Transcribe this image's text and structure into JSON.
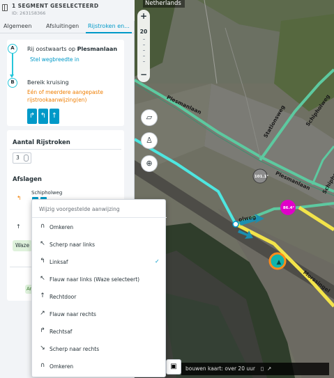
{
  "header": {
    "title": "1 SEGMENT GESELECTEERD",
    "id": "ID: 263158366"
  },
  "tabs": [
    {
      "label": "Algemeen"
    },
    {
      "label": "Afsluitingen"
    },
    {
      "label": "Rijstroken en..."
    }
  ],
  "direction": {
    "node_a": "A",
    "node_b": "B",
    "line_prefix": "Rij oostwaarts op ",
    "street": "Plesmanlaan",
    "width_link": "Stel wegbreedte in",
    "reach_junction": "Bereik kruising",
    "warning": "Eén of meerdere aangepaste rijstrookaanwijzing(en)",
    "lane_icons": [
      "↱",
      "↰",
      "↑"
    ]
  },
  "lanes": {
    "count_label": "Aantal Rijstroken",
    "count_value": "3",
    "turns_label": "Afslagen",
    "street": "Schipholweg",
    "waze_chip": "Waze",
    "bottom_chip": "An"
  },
  "map": {
    "country": "Netherlands",
    "zoom_level": "20",
    "labels": {
      "plesmanlaan_top": "Plesmanlaan",
      "plesmanlaan_mid": "Plesmanlaan",
      "stationsweg": "Stationsweg",
      "schipholweg_ne": "Schipholweg",
      "schipholweg_e": "Schipholweg",
      "schipholweg_w": "olweg",
      "morssingel": "Morssingel",
      "speed_grey": "101.1°",
      "speed_pink": "86.4°"
    },
    "footer": "bouwen kaart: over 20 uur",
    "colors": {
      "road_green": "#5dc9a0",
      "road_cyan": "#4ee6e0",
      "road_yellow": "#f2e34a",
      "accent": "#0099c8"
    }
  },
  "dropdown": {
    "heading": "Wijzig voorgestelde aanwijzing",
    "items": [
      {
        "label": "Omkeren",
        "icon": "u-turn-left-icon",
        "glyph": "∩",
        "checked": false
      },
      {
        "label": "Scherp naar links",
        "icon": "sharp-left-icon",
        "glyph": "↖",
        "checked": false
      },
      {
        "label": "Linksaf",
        "icon": "turn-left-icon",
        "glyph": "↰",
        "checked": true
      },
      {
        "label": "Flauw naar links (Waze selecteert)",
        "icon": "slight-left-icon",
        "glyph": "↖",
        "checked": false
      },
      {
        "label": "Rechtdoor",
        "icon": "straight-icon",
        "glyph": "↑",
        "checked": false
      },
      {
        "label": "Flauw naar rechts",
        "icon": "slight-right-icon",
        "glyph": "↗",
        "checked": false
      },
      {
        "label": "Rechtsaf",
        "icon": "turn-right-icon",
        "glyph": "↱",
        "checked": false
      },
      {
        "label": "Scherp naar rechts",
        "icon": "sharp-right-icon",
        "glyph": "↘",
        "checked": false
      },
      {
        "label": "Omkeren",
        "icon": "u-turn-right-icon",
        "glyph": "∩",
        "checked": false
      }
    ],
    "check_glyph": "✓"
  }
}
